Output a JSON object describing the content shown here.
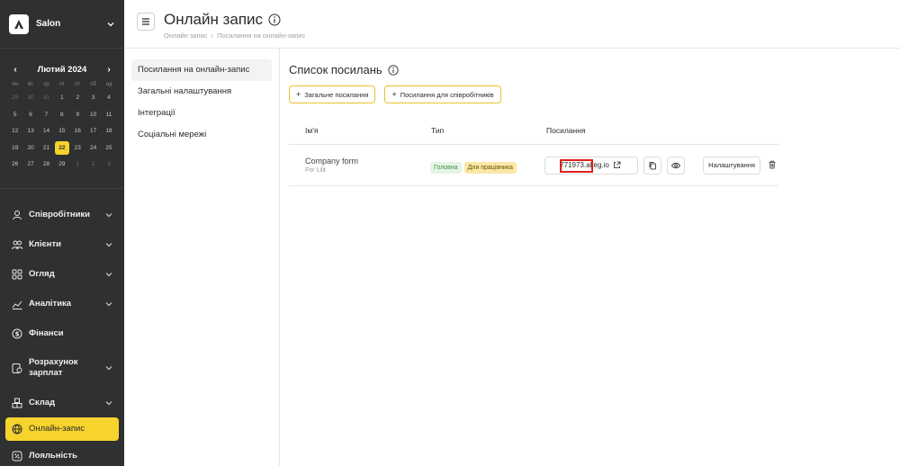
{
  "sidebar": {
    "brand": "Salon",
    "calendar": {
      "month_label": "Лютий 2024",
      "prev": "‹",
      "next": "›",
      "weekdays": [
        "пн",
        "вт",
        "ср",
        "чт",
        "пт",
        "сб",
        "нд"
      ],
      "days": [
        "29",
        "30",
        "31",
        "1",
        "2",
        "3",
        "4",
        "5",
        "6",
        "7",
        "8",
        "9",
        "10",
        "11",
        "12",
        "13",
        "14",
        "15",
        "16",
        "17",
        "18",
        "19",
        "20",
        "21",
        "22",
        "23",
        "24",
        "25",
        "26",
        "27",
        "28",
        "29",
        "1",
        "2",
        "3"
      ]
    },
    "nav": [
      {
        "label": "Співробітники",
        "icon": "person-icon"
      },
      {
        "label": "Клієнти",
        "icon": "people-icon"
      },
      {
        "label": "Огляд",
        "icon": "grid-icon"
      },
      {
        "label": "Аналітика",
        "icon": "chart-icon"
      },
      {
        "label": "Фінанси",
        "icon": "dollar-icon"
      },
      {
        "label": "Розрахунок зарплат",
        "icon": "payroll-icon"
      },
      {
        "label": "Склад",
        "icon": "boxes-icon"
      },
      {
        "label": "Онлайн-запис",
        "icon": "globe-calendar-icon"
      },
      {
        "label": "Лояльність",
        "icon": "percent-icon"
      }
    ]
  },
  "header": {
    "title": "Онлайн запис",
    "breadcrumb": [
      "Онлайн запис",
      "Посилання на онлайн-запис"
    ]
  },
  "subnav": [
    "Посилання на онлайн-запис",
    "Загальні налаштування",
    "Інтеграції",
    "Соціальні мережі"
  ],
  "main": {
    "section_title": "Список посилань",
    "btn_general": "Загальне посилання",
    "btn_staff": "Посилання для співробітників",
    "columns": [
      "Ім'я",
      "Тип",
      "Посилання"
    ],
    "rows": [
      {
        "name": "Company form",
        "sub": "For Lilit",
        "badges": [
          "Головна",
          "Для працівника"
        ],
        "link": "771973.alteg.io",
        "settings": "Налаштування"
      }
    ]
  },
  "colors": {
    "accent": "#f6d32d",
    "sidebar_bg": "#2f3031",
    "highlight": "#e0201c"
  }
}
